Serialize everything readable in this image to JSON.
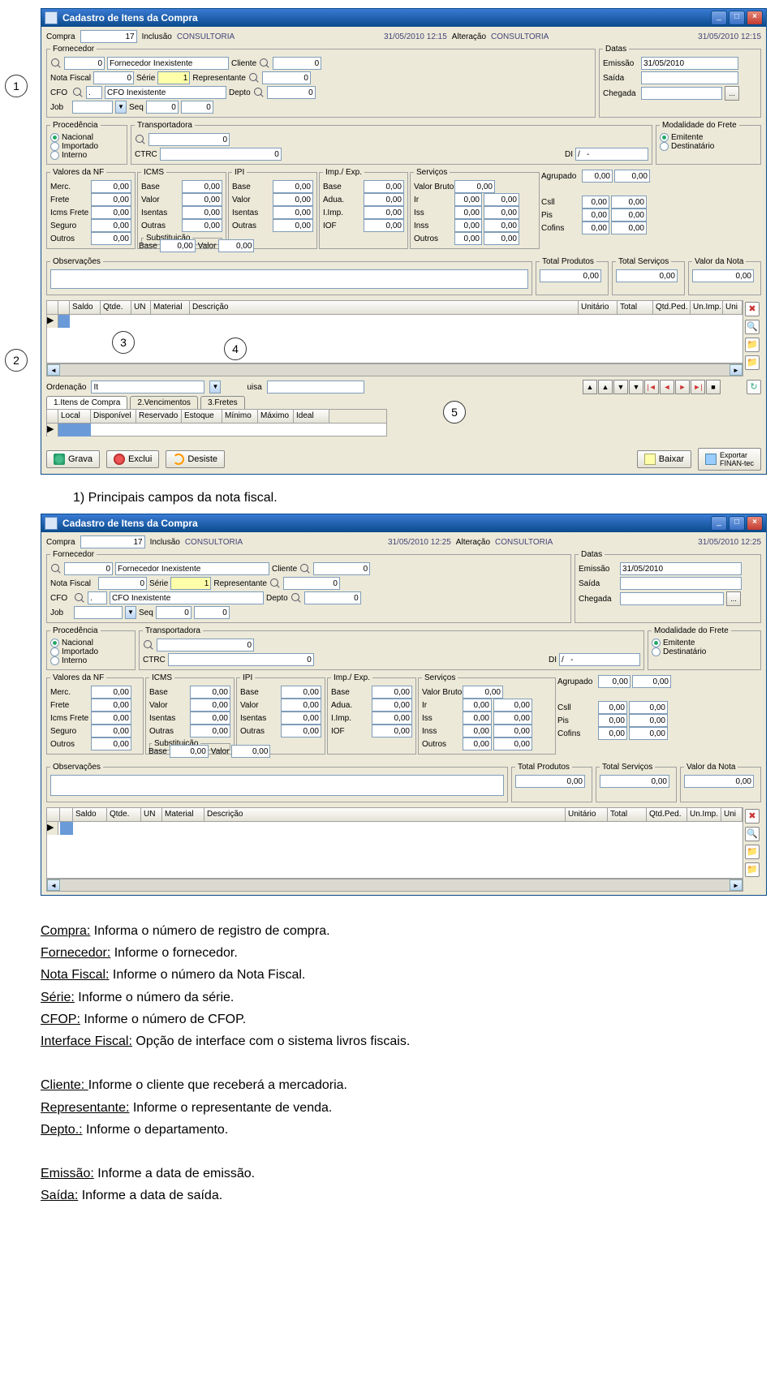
{
  "callouts": {
    "c1": "1",
    "c2": "2",
    "c3": "3",
    "c4": "4",
    "c5": "5"
  },
  "win1": {
    "title": "Cadastro de Itens da Compra",
    "header": {
      "compra_lbl": "Compra",
      "compra_val": "17",
      "inclusao_lbl": "Inclusão",
      "inclusao_val": "CONSULTORIA",
      "inclusao_dt": "31/05/2010 12:15",
      "alteracao_lbl": "Alteração",
      "alteracao_val": "CONSULTORIA",
      "alteracao_dt": "31/05/2010 12:15"
    },
    "fornecedor": {
      "legend": "Fornecedor",
      "forn_val": "0",
      "forn_name": "Fornecedor Inexistente",
      "cliente_lbl": "Cliente",
      "cliente_val": "0",
      "nf_lbl": "Nota Fiscal",
      "nf_val": "0",
      "serie_lbl": "Série",
      "serie_val": "1",
      "repr_lbl": "Representante",
      "repr_val": "0",
      "cfo_lbl": "CFO",
      "cfo_val": ".",
      "cfo_name": "CFO Inexistente",
      "depto_lbl": "Depto",
      "depto_val": "0",
      "job_lbl": "Job",
      "seq_lbl": "Seq",
      "seq_v1": "0",
      "seq_v2": "0"
    },
    "datas": {
      "legend": "Datas",
      "emissao_lbl": "Emissão",
      "emissao_val": "31/05/2010",
      "saida_lbl": "Saída",
      "chegada_lbl": "Chegada",
      "chegada_btn": "..."
    },
    "proc": {
      "legend": "Procedência",
      "nacional": "Nacional",
      "importado": "Importado",
      "interno": "Interno"
    },
    "transp": {
      "legend": "Transportadora",
      "val": "0",
      "ctrc_lbl": "CTRC",
      "ctrc_val": "0",
      "di_lbl": "DI",
      "di_val": "/   -"
    },
    "frete": {
      "legend": "Modalidade do Frete",
      "emitente": "Emitente",
      "destinatario": "Destinatário"
    },
    "valnf": {
      "legend": "Valores da NF",
      "merc": "Merc.",
      "frete": "Frete",
      "icmsfrete": "Icms Frete",
      "seguro": "Seguro",
      "outros": "Outros",
      "v": "0,00"
    },
    "icms": {
      "legend": "ICMS",
      "base": "Base",
      "valor": "Valor",
      "isentas": "Isentas",
      "outras": "Outras",
      "v": "0,00",
      "sub": "Substituição",
      "sub_base": "Base",
      "sub_valor": "Valor"
    },
    "ipi": {
      "legend": "IPI",
      "base": "Base",
      "valor": "Valor",
      "isentas": "Isentas",
      "outras": "Outras",
      "v": "0,00"
    },
    "impexp": {
      "legend": "Imp./ Exp.",
      "base": "Base",
      "adua": "Adua.",
      "iimp": "I.Imp.",
      "iof": "IOF",
      "v": "0,00"
    },
    "serv": {
      "legend": "Serviços",
      "vb": "Valor Bruto",
      "ir": "Ir",
      "iss": "Iss",
      "inss": "Inss",
      "outros": "Outros",
      "v": "0,00"
    },
    "agr": {
      "lbl": "Agrupado",
      "v1": "0,00",
      "v2": "0,00"
    },
    "right": {
      "csll": "Csll",
      "pis": "Pis",
      "cofins": "Cofins",
      "v": "0,00"
    },
    "obs": {
      "legend": "Observações"
    },
    "totals": {
      "tp": "Total Produtos",
      "ts": "Total Serviços",
      "vn": "Valor da Nota",
      "v": "0,00"
    },
    "grid": {
      "cols": [
        "",
        "",
        "Saldo",
        "Qtde.",
        "UN",
        "Material",
        "Descrição",
        "Unitário",
        "Total",
        "Qtd.Ped.",
        "Un.Imp.",
        "Uni"
      ]
    },
    "ord": {
      "lbl": "Ordenação",
      "val": "It",
      "uisa": "uisa"
    },
    "tabs": [
      "1.Itens de Compra",
      "2.Vencimentos",
      "3.Fretes"
    ],
    "grid2": {
      "cols": [
        "Local",
        "Disponível",
        "Reservado",
        "Estoque",
        "Mínimo",
        "Máximo",
        "Ideal"
      ]
    },
    "btns": {
      "grava": "Grava",
      "exclui": "Exclui",
      "desiste": "Desiste",
      "baixar": "Baixar",
      "exportar1": "Exportar",
      "exportar2": "FINAN-tec"
    }
  },
  "heading1": "1)  Principais campos da nota fiscal.",
  "win2": {
    "title": "Cadastro de Itens da Compra",
    "header": {
      "compra_lbl": "Compra",
      "compra_val": "17",
      "inclusao_lbl": "Inclusão",
      "inclusao_val": "CONSULTORIA",
      "inclusao_dt": "31/05/2010 12:25",
      "alteracao_lbl": "Alteração",
      "alteracao_val": "CONSULTORIA",
      "alteracao_dt": "31/05/2010 12:25"
    }
  },
  "instr": {
    "compra": "Compra: Informa o número de registro de compra.",
    "compra_u": "Compra:",
    "forn": "Fornecedor: Informe o fornecedor.",
    "forn_u": "Fornecedor:",
    "nf": "Nota Fiscal: Informe o número da Nota Fiscal.",
    "nf_u": "Nota Fiscal:",
    "serie": "Série: Informe o número da série.",
    "serie_u": "Série:",
    "cfop": "CFOP: Informe o número de CFOP.",
    "cfop_u": "CFOP:",
    "interf": "Interface Fiscal:  Opção de interface com o sistema livros fiscais.",
    "interf_u": "Interface Fiscal:",
    "cliente": "Cliente: Informe o cliente que receberá a mercadoria.",
    "cliente_u": "Cliente: ",
    "repr": "Representante: Informe o representante de venda.",
    "repr_u": "Representante:",
    "depto": "Depto.: Informe o departamento. ",
    "depto_u": "Depto.:",
    "emissao": "Emissão:  Informe a data de emissão.",
    "emissao_u": "Emissão:",
    "saida": "Saída:  Informe a data de saída.",
    "saida_u": "Saída:"
  }
}
